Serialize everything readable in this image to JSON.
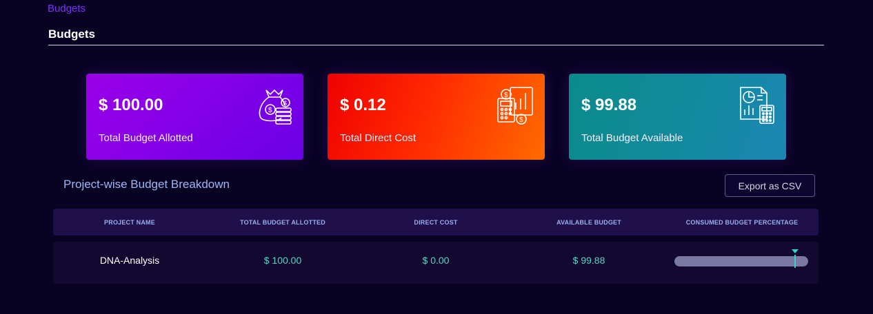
{
  "breadcrumb": "Budgets",
  "page_title": "Budgets",
  "cards": [
    {
      "value": "$ 100.00",
      "label": "Total Budget Allotted",
      "icon": "money-bag-coins-icon"
    },
    {
      "value": "$ 0.12",
      "label": "Total Direct Cost",
      "icon": "calculator-chart-icon"
    },
    {
      "value": "$ 99.88",
      "label": "Total Budget Available",
      "icon": "report-calculator-icon"
    }
  ],
  "section_title": "Project-wise Budget Breakdown",
  "export_label": "Export as CSV",
  "table": {
    "headers": [
      "PROJECT NAME",
      "TOTAL BUDGET ALLOTTED",
      "DIRECT COST",
      "AVAILABLE BUDGET",
      "CONSUMED BUDGET PERCENTAGE"
    ],
    "rows": [
      {
        "project": "DNA-Analysis",
        "total": "$ 100.00",
        "direct": "$ 0.00",
        "available": "$ 99.88",
        "consumed_fraction": 0.9
      }
    ]
  },
  "colors": {
    "background": "#090323",
    "accent": "#7b2ff7",
    "money_text": "#55d6c2",
    "progress_marker": "#2fd6c0"
  }
}
